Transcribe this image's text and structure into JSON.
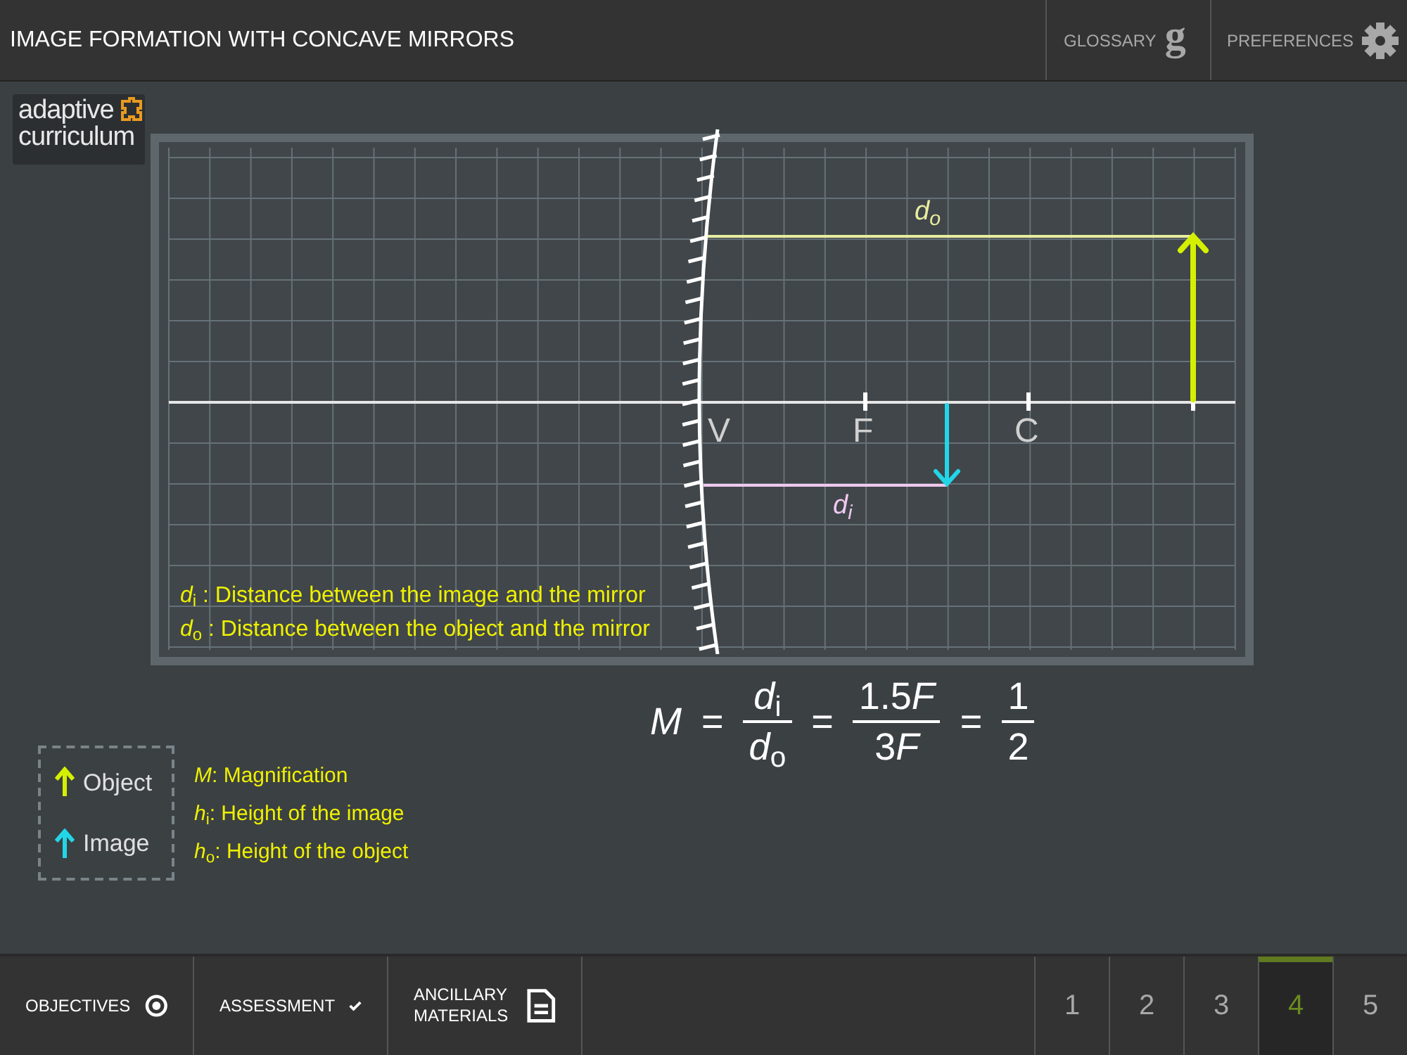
{
  "header": {
    "title": "IMAGE FORMATION WITH CONCAVE MIRRORS",
    "actions": [
      {
        "kind": "glossary",
        "label": "GLOSSARY",
        "glyph": "g"
      },
      {
        "kind": "preferences",
        "label": "PREFERENCES"
      }
    ]
  },
  "logo": {
    "line_1": "adaptive",
    "line_2": "curriculum"
  },
  "diagram": {
    "object_distance_label": "d$_{o}$",
    "image_distance_label": "d$_{i}$",
    "points": [
      {
        "label": "V"
      },
      {
        "label": "F"
      },
      {
        "label": "C"
      }
    ],
    "definitions": [
      "*d*$_{i}$ : Distance between the image and the mirror",
      "*d*$_{o}$ : Distance between the object and the mirror"
    ]
  },
  "formula": {
    "lhs": "M",
    "terms": [
      {
        "equals": "=",
        "numerator": "*d*$_{i}$",
        "denominator": "*d*$_{o}$"
      },
      {
        "equals": "=",
        "numerator": "1.5",
        "numerator_variable": "F",
        "denominator": "3",
        "denominator_variable": "F"
      },
      {
        "equals": "=",
        "numerator": "1",
        "denominator": "2"
      }
    ]
  },
  "legend": [
    {
      "label": "Object",
      "color": "#d4f000"
    },
    {
      "label": "Image",
      "color": "#22d6e8"
    }
  ],
  "symbols": [
    "*M*: Magnification",
    "*h*$_{i}$: Height of the image",
    "*h*$_{o}$: Height of the object"
  ],
  "footer": {
    "links": [
      {
        "kind": "objectives",
        "label": "OBJECTIVES"
      },
      {
        "kind": "assessment",
        "label": "ASSESSMENT"
      },
      {
        "kind": "materials",
        "label": "ANCILLARY MATERIALS"
      }
    ],
    "pages": [
      {
        "label": "1",
        "selected": false
      },
      {
        "label": "2",
        "selected": false
      },
      {
        "label": "3",
        "selected": false
      },
      {
        "label": "4",
        "selected": true
      },
      {
        "label": "5",
        "selected": false
      }
    ]
  }
}
